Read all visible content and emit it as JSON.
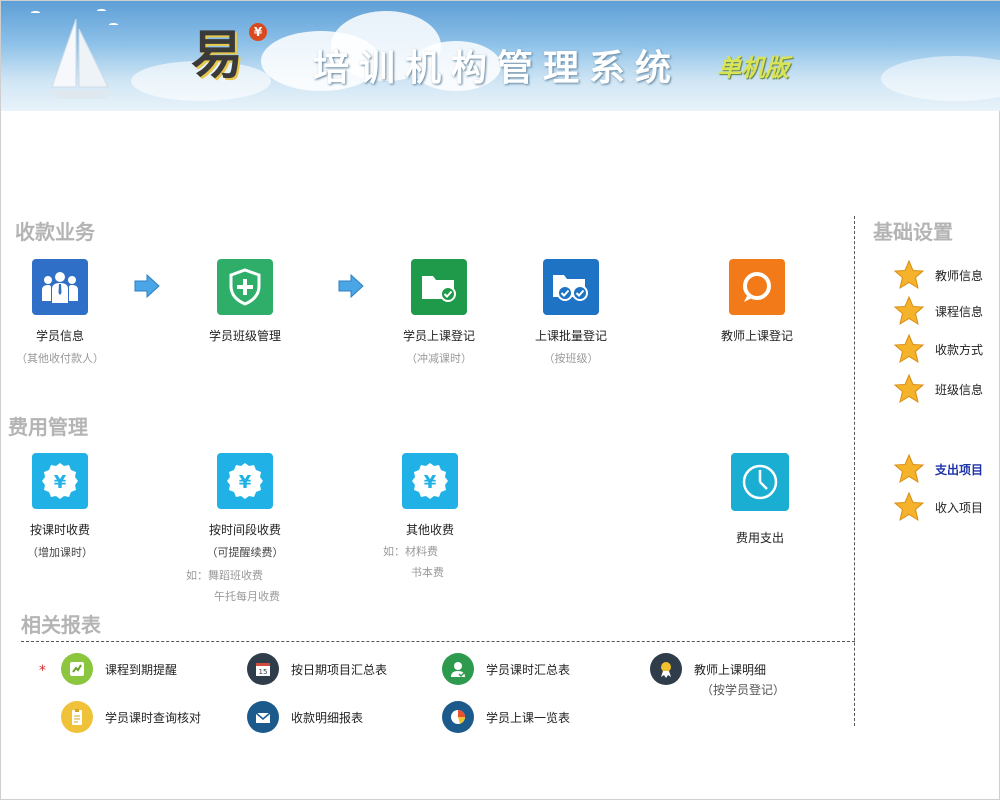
{
  "header": {
    "logo_char": "易",
    "logo_badge": "¥",
    "title": "培训机构管理系统",
    "edition": "单机版"
  },
  "sections": {
    "receipts": "收款业务",
    "fees": "费用管理",
    "reports": "相关报表",
    "basic": "基础设置"
  },
  "receipts": [
    {
      "label": "学员信息",
      "sub": "（其他收付款人）",
      "icon": "students-icon",
      "color": "#2f6fc7"
    },
    {
      "label": "学员班级管理",
      "sub": "",
      "icon": "shield-plus-icon",
      "color": "#2fae6a"
    },
    {
      "label": "学员上课登记",
      "sub": "（冲减课时）",
      "icon": "folder-check-icon",
      "color": "#1e9a4a"
    },
    {
      "label": "上课批量登记",
      "sub": "（按班级）",
      "icon": "folder-double-check-icon",
      "color": "#1f73c4"
    },
    {
      "label": "教师上课登记",
      "sub": "",
      "icon": "chat-bubble-icon",
      "color": "#f27a18"
    }
  ],
  "fees": [
    {
      "label": "按课时收费",
      "sub": "（增加课时）",
      "icon": "yen-badge-icon",
      "color": "#20b2e6"
    },
    {
      "label": "按时间段收费",
      "sub": "（可提醒续费）",
      "icon": "yen-badge-icon",
      "color": "#20b2e6"
    },
    {
      "label": "其他收费",
      "sub": "",
      "icon": "yen-badge-icon",
      "color": "#20b2e6"
    },
    {
      "label": "费用支出",
      "sub": "",
      "icon": "clock-icon",
      "color": "#19aed2"
    }
  ],
  "fee_notes": {
    "time_1": "如：舞蹈班收费",
    "time_2": "午托每月收费",
    "other_1": "如：材料费",
    "other_2": "书本费"
  },
  "sidebar": {
    "items": [
      {
        "label": "教师信息"
      },
      {
        "label": "课程信息"
      },
      {
        "label": "收款方式"
      },
      {
        "label": "班级信息"
      },
      {
        "label": "支出项目",
        "active": true
      },
      {
        "label": "收入项目"
      }
    ]
  },
  "reports": {
    "required_mark": "*",
    "items": [
      {
        "label": "课程到期提醒",
        "icon": "reminder-icon"
      },
      {
        "label": "按日期项目汇总表",
        "icon": "calendar-icon"
      },
      {
        "label": "学员课时汇总表",
        "icon": "user-check-icon"
      },
      {
        "label": "教师上课明细",
        "sub": "（按学员登记）",
        "icon": "award-ribbon-icon"
      },
      {
        "label": "学员课时查询核对",
        "icon": "clipboard-icon"
      },
      {
        "label": "收款明细报表",
        "icon": "envelope-icon"
      },
      {
        "label": "学员上课一览表",
        "icon": "pie-chart-icon"
      }
    ]
  }
}
